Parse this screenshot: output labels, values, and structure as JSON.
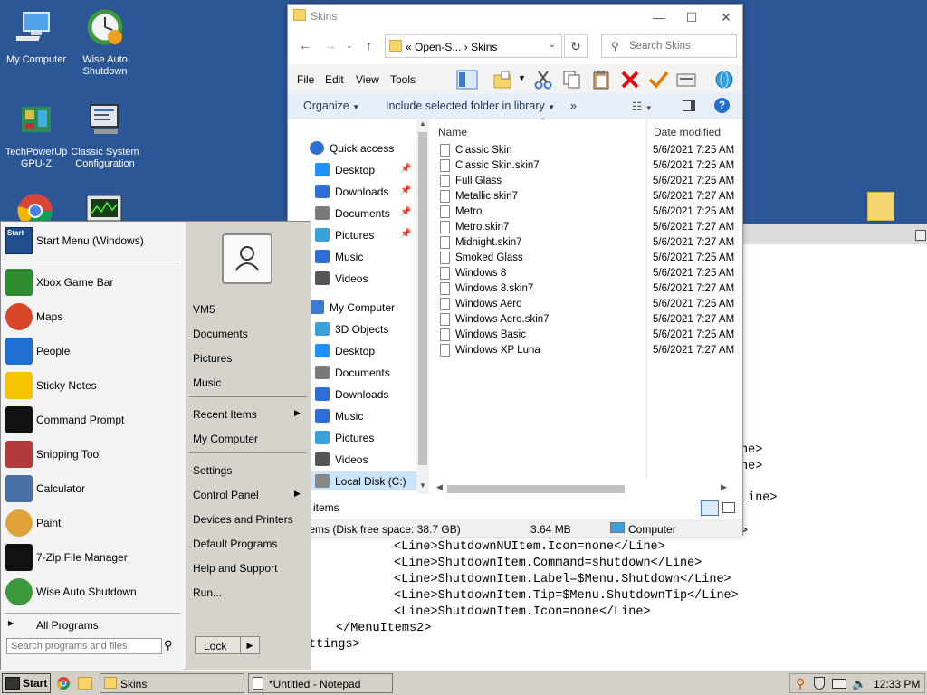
{
  "desktop": {
    "icons": [
      {
        "label": "My Computer"
      },
      {
        "label": "Wise Auto Shutdown"
      },
      {
        "label": "TechPowerUp GPU-Z"
      },
      {
        "label": "Classic System Configuration"
      }
    ],
    "background": "#2b5797"
  },
  "notepad": {
    "lines": [
      "ne>",
      "ne>",
      "Line>",
      ">",
      "<Line>ShutdownNUItem.Icon=none</Line>",
      "<Line>ShutdownItem.Command=shutdown</Line>",
      "<Line>ShutdownItem.Label=$Menu.Shutdown</Line>",
      "<Line>ShutdownItem.Tip=$Menu.ShutdownTip</Line>",
      "<Line>ShutdownItem.Icon=none</Line>",
      "</MenuItems2>",
      "ttings>"
    ]
  },
  "explorer": {
    "title": "Skins",
    "window_controls": {
      "minimize": "—",
      "maximize": "☐",
      "close": "✕"
    },
    "address": {
      "breadcrumb_prefix": "«",
      "part1": "Open-S...",
      "sep": "›",
      "part2": "Skins"
    },
    "search_placeholder": "Search Skins",
    "menu": [
      "File",
      "Edit",
      "View",
      "Tools"
    ],
    "commands": {
      "organize": "Organize",
      "include": "Include selected folder in library",
      "more": "»"
    },
    "nav": [
      {
        "label": "Quick access",
        "icon": "star-icon",
        "color": "#2f6fd3",
        "pinned": false
      },
      {
        "label": "Desktop",
        "icon": "desktop-icon",
        "color": "#1e90ff",
        "pinned": true
      },
      {
        "label": "Downloads",
        "icon": "download-icon",
        "color": "#2f6fd3",
        "pinned": true
      },
      {
        "label": "Documents",
        "icon": "documents-icon",
        "color": "#7a7a7a",
        "pinned": true
      },
      {
        "label": "Pictures",
        "icon": "pictures-icon",
        "color": "#3aa0d8",
        "pinned": true
      },
      {
        "label": "Music",
        "icon": "music-icon",
        "color": "#2f6fd3",
        "pinned": false
      },
      {
        "label": "Videos",
        "icon": "videos-icon",
        "color": "#555555",
        "pinned": false
      },
      {
        "label": "My Computer",
        "icon": "computer-icon",
        "color": "#3a7bd5",
        "pinned": false
      },
      {
        "label": "3D Objects",
        "icon": "cube-icon",
        "color": "#3aa0d8",
        "pinned": false
      },
      {
        "label": "Desktop",
        "icon": "desktop-icon",
        "color": "#1e90ff",
        "pinned": false
      },
      {
        "label": "Documents",
        "icon": "documents-icon",
        "color": "#7a7a7a",
        "pinned": false
      },
      {
        "label": "Downloads",
        "icon": "download-icon",
        "color": "#2f6fd3",
        "pinned": false
      },
      {
        "label": "Music",
        "icon": "music-icon",
        "color": "#2f6fd3",
        "pinned": false
      },
      {
        "label": "Pictures",
        "icon": "pictures-icon",
        "color": "#3aa0d8",
        "pinned": false
      },
      {
        "label": "Videos",
        "icon": "videos-icon",
        "color": "#555555",
        "pinned": false
      },
      {
        "label": "Local Disk (C:)",
        "icon": "drive-icon",
        "color": "#888888",
        "pinned": false
      }
    ],
    "columns": {
      "name": "Name",
      "date": "Date modified"
    },
    "files": [
      {
        "name": "Classic Skin",
        "date": "5/6/2021 7:25 AM"
      },
      {
        "name": "Classic Skin.skin7",
        "date": "5/6/2021 7:25 AM"
      },
      {
        "name": "Full Glass",
        "date": "5/6/2021 7:25 AM"
      },
      {
        "name": "Metallic.skin7",
        "date": "5/6/2021 7:27 AM"
      },
      {
        "name": "Metro",
        "date": "5/6/2021 7:25 AM"
      },
      {
        "name": "Metro.skin7",
        "date": "5/6/2021 7:27 AM"
      },
      {
        "name": "Midnight.skin7",
        "date": "5/6/2021 7:27 AM"
      },
      {
        "name": "Smoked Glass",
        "date": "5/6/2021 7:25 AM"
      },
      {
        "name": "Windows 8",
        "date": "5/6/2021 7:25 AM"
      },
      {
        "name": "Windows 8.skin7",
        "date": "5/6/2021 7:27 AM"
      },
      {
        "name": "Windows Aero",
        "date": "5/6/2021 7:25 AM"
      },
      {
        "name": "Windows Aero.skin7",
        "date": "5/6/2021 7:27 AM"
      },
      {
        "name": "Windows Basic",
        "date": "5/6/2021 7:25 AM"
      },
      {
        "name": "Windows XP Luna",
        "date": "5/6/2021 7:27 AM"
      }
    ],
    "status": {
      "items": "items",
      "disk": "tems (Disk free space: 38.7 GB)",
      "size": "3.64 MB",
      "location": "Computer"
    }
  },
  "startmenu": {
    "header": "Start Menu (Windows)",
    "programs": [
      {
        "label": "Xbox Game Bar",
        "icon": "xbox-icon",
        "color": "#2e8b2e"
      },
      {
        "label": "Maps",
        "icon": "map-pin-icon",
        "color": "#d9472b"
      },
      {
        "label": "People",
        "icon": "people-icon",
        "color": "#1f6fd1"
      },
      {
        "label": "Sticky Notes",
        "icon": "sticky-note-icon",
        "color": "#f5c400"
      },
      {
        "label": "Command Prompt",
        "icon": "terminal-icon",
        "color": "#111111"
      },
      {
        "label": "Snipping Tool",
        "icon": "scissors-icon",
        "color": "#b33a3a"
      },
      {
        "label": "Calculator",
        "icon": "calculator-icon",
        "color": "#4a6fa5"
      },
      {
        "label": "Paint",
        "icon": "palette-icon",
        "color": "#e2a23b"
      },
      {
        "label": "7-Zip File Manager",
        "icon": "zip-icon",
        "color": "#111111"
      },
      {
        "label": "Wise Auto Shutdown",
        "icon": "power-clock-icon",
        "color": "#3c9a3c"
      }
    ],
    "all_programs": "All Programs",
    "search_placeholder": "Search programs and files",
    "right": {
      "user": "VM5",
      "group1": [
        "Documents",
        "Pictures",
        "Music"
      ],
      "recent": "Recent Items",
      "mycomputer": "My Computer",
      "settings": "Settings",
      "control_panel": "Control Panel",
      "devices": "Devices and Printers",
      "default_programs": "Default Programs",
      "help": "Help and Support",
      "run": "Run...",
      "lock": "Lock"
    }
  },
  "taskbar": {
    "start": "Start",
    "tasks": [
      "Skins",
      "*Untitled - Notepad"
    ],
    "clock": "12:33 PM"
  }
}
